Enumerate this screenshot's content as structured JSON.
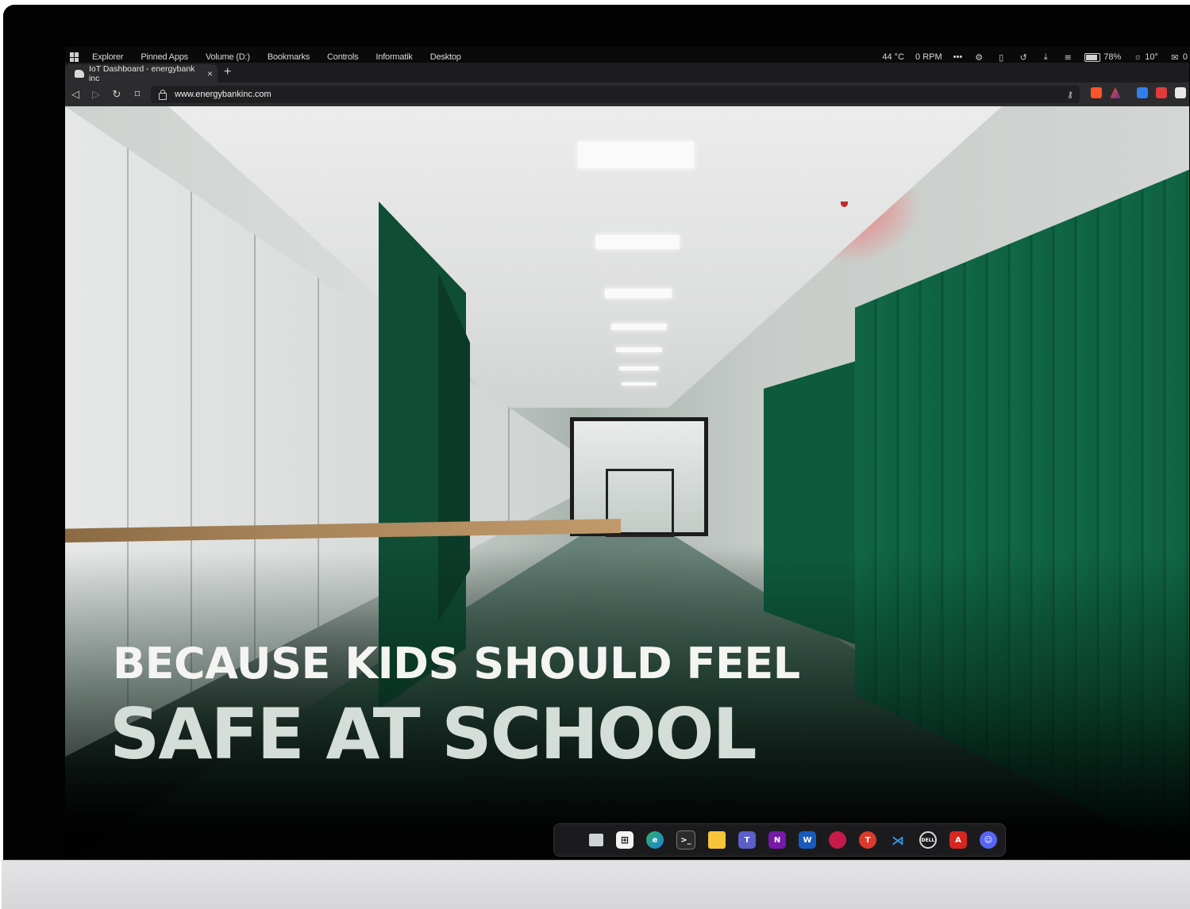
{
  "menubar": {
    "items": [
      "Explorer",
      "Pinned Apps",
      "Volume (D:)",
      "Bookmarks",
      "Controls",
      "Informatik",
      "Desktop"
    ],
    "temperature": "44 °C",
    "fan": "0 RPM",
    "more": "•••",
    "battery": "78%",
    "brightness": "10°",
    "mail_count": "0"
  },
  "browser": {
    "tab_title": "IoT Dashboard - energybank inc",
    "tab_close": "×",
    "new_tab": "+",
    "url": "www.energybankinc.com"
  },
  "hero": {
    "line1": "BECAUSE KIDS SHOULD FEEL",
    "line2": "SAFE AT SCHOOL"
  },
  "taskbar": {
    "apps": [
      "start-icon",
      "task-view-icon",
      "store-icon",
      "edge-icon",
      "terminal-icon",
      "file-explorer-icon",
      "teams-icon",
      "onenote-icon",
      "word-icon",
      "raspberry-icon",
      "todoist-icon",
      "vscode-icon",
      "dell-icon",
      "acrobat-icon",
      "discord-icon"
    ]
  },
  "colors": {
    "accent_green": "#0f6142",
    "alarm_red": "#ff5050",
    "headline_white": "#f4f4f2"
  }
}
